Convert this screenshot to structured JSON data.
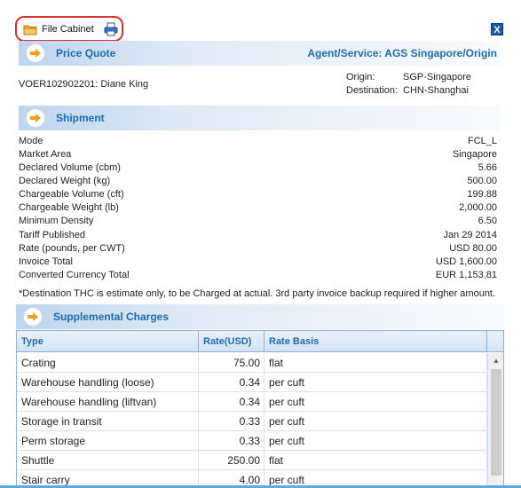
{
  "toolbar": {
    "file_cabinet_label": "File Cabinet"
  },
  "close_label": "X",
  "price_quote": {
    "title": "Price Quote",
    "agent_service": "Agent/Service: AGS Singapore/Origin",
    "reference": "VOER102902201: Diane King",
    "origin_label": "Origin:",
    "origin_value": "SGP-Singapore",
    "destination_label": "Destination:",
    "destination_value": "CHN-Shanghai"
  },
  "shipment": {
    "title": "Shipment",
    "rows": [
      {
        "label": "Mode",
        "value": "FCL_L"
      },
      {
        "label": "Market Area",
        "value": "Singapore"
      },
      {
        "label": "Declared Volume (cbm)",
        "value": "5.66"
      },
      {
        "label": "Declared Weight (kg)",
        "value": "500.00"
      },
      {
        "label": "Chargeable Volume (cft)",
        "value": "199.88"
      },
      {
        "label": "Chargeable Weight (lb)",
        "value": "2,000.00"
      },
      {
        "label": "Minimum Density",
        "value": "6.50"
      },
      {
        "label": "Tariff Published",
        "value": "Jan 29 2014"
      },
      {
        "label": "Rate (pounds, per CWT)",
        "value": "USD 80.00"
      },
      {
        "label": "Invoice Total",
        "value": "USD 1,600.00"
      },
      {
        "label": "Converted Currency Total",
        "value": "EUR 1,153.81"
      }
    ],
    "note": "*Destination THC is estimate only, to be Charged at actual. 3rd party invoice backup required if higher amount."
  },
  "supplemental": {
    "title": "Supplemental Charges",
    "headers": [
      "Type",
      "Rate(USD)",
      "Rate Basis"
    ],
    "rows": [
      {
        "type": "Crating",
        "rate": "75.00",
        "basis": "flat"
      },
      {
        "type": "Warehouse handling (loose)",
        "rate": "0.34",
        "basis": "per cuft"
      },
      {
        "type": "Warehouse handling (liftvan)",
        "rate": "0.34",
        "basis": "per cuft"
      },
      {
        "type": "Storage in transit",
        "rate": "0.33",
        "basis": "per cuft"
      },
      {
        "type": "Perm storage",
        "rate": "0.33",
        "basis": "per cuft"
      },
      {
        "type": "Shuttle",
        "rate": "250.00",
        "basis": "flat"
      },
      {
        "type": "Stair carry",
        "rate": "4.00",
        "basis": "per cuft"
      }
    ]
  },
  "colors": {
    "accent": "#1f6bae",
    "highlight_border": "#e03030",
    "arrow": "#f0a020"
  }
}
